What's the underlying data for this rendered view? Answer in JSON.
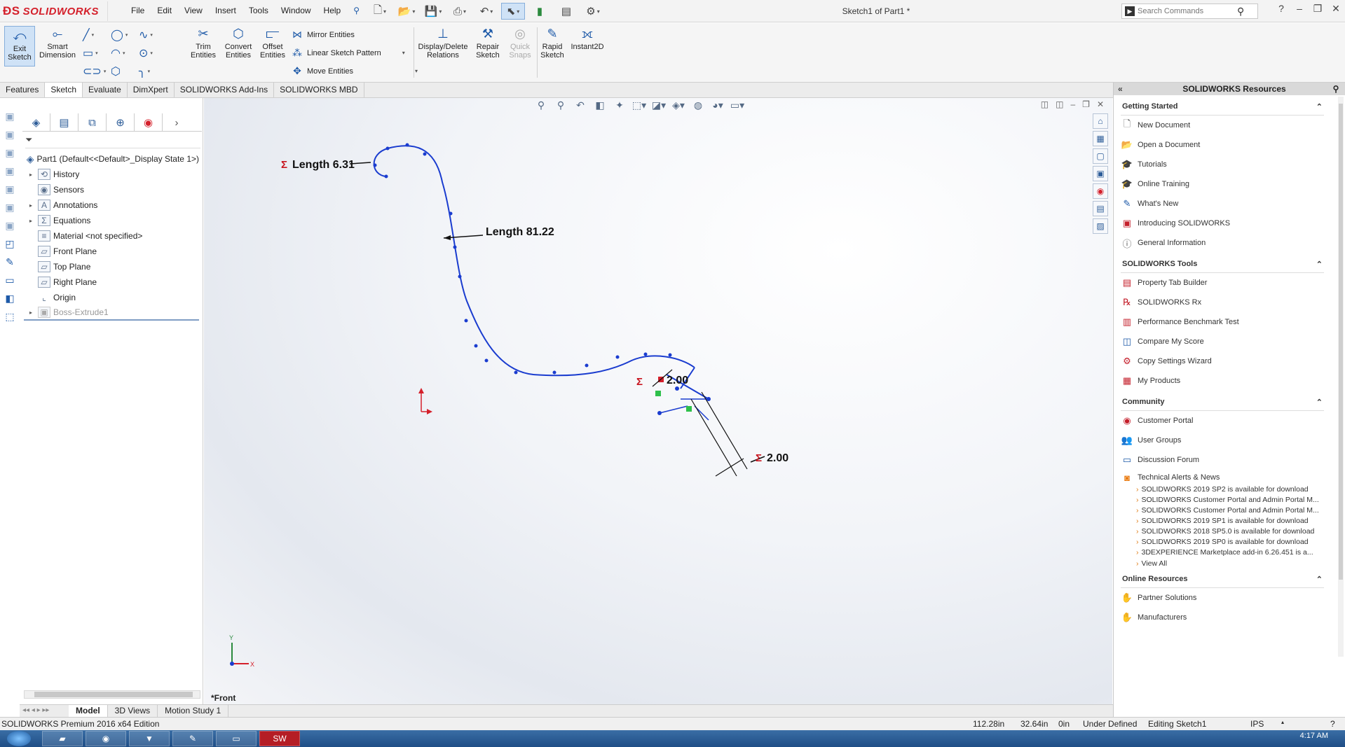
{
  "app": {
    "brand": "SOLIDWORKS",
    "doc_title": "Sketch1 of Part1 *"
  },
  "menu": [
    "File",
    "Edit",
    "View",
    "Insert",
    "Tools",
    "Window",
    "Help"
  ],
  "search": {
    "placeholder": "Search Commands"
  },
  "commands": {
    "exit_sketch": "Exit Sketch",
    "smart_dimension": "Smart Dimension",
    "trim_entities": "Trim Entities",
    "convert_entities": "Convert Entities",
    "offset_entities": "Offset Entities",
    "mirror_entities": "Mirror Entities",
    "linear_sketch_pattern": "Linear Sketch Pattern",
    "move_entities": "Move Entities",
    "display_delete_relations": "Display/Delete Relations",
    "repair_sketch": "Repair Sketch",
    "quick_snaps": "Quick Snaps",
    "rapid_sketch": "Rapid Sketch",
    "instant2d": "Instant2D"
  },
  "cm_tabs": [
    "Features",
    "Sketch",
    "Evaluate",
    "DimXpert",
    "SOLIDWORKS Add-Ins",
    "SOLIDWORKS MBD"
  ],
  "tree": {
    "root": "Part1  (Default<<Default>_Display State 1>)",
    "items": [
      "History",
      "Sensors",
      "Annotations",
      "Equations",
      "Material <not specified>",
      "Front Plane",
      "Top Plane",
      "Right Plane",
      "Origin",
      "Boss-Extrude1"
    ]
  },
  "model_tabs": [
    "Model",
    "3D Views",
    "Motion Study 1"
  ],
  "graphics": {
    "view_name": "*Front",
    "dims": {
      "length1": "Length 6.31",
      "length2": "Length 81.22",
      "dim_a": "2.00",
      "dim_b": "2.00"
    },
    "sigma": "Σ",
    "axis_x": "X",
    "axis_y": "Y"
  },
  "taskpane": {
    "title": "SOLIDWORKS Resources",
    "getting_started": {
      "title": "Getting Started",
      "items": [
        "New Document",
        "Open a Document",
        "Tutorials",
        "Online Training",
        "What's New",
        "Introducing SOLIDWORKS",
        "General Information"
      ]
    },
    "tools": {
      "title": "SOLIDWORKS Tools",
      "items": [
        "Property Tab Builder",
        "SOLIDWORKS Rx",
        "Performance Benchmark Test",
        "Compare My Score",
        "Copy Settings Wizard",
        "My Products"
      ]
    },
    "community": {
      "title": "Community",
      "items": [
        "Customer Portal",
        "User Groups",
        "Discussion Forum",
        "Technical Alerts & News"
      ]
    },
    "news": [
      "SOLIDWORKS 2019 SP2 is available for download",
      "SOLIDWORKS Customer Portal and Admin Portal M...",
      "SOLIDWORKS Customer Portal and Admin Portal M...",
      "SOLIDWORKS 2019 SP1 is available for download",
      "SOLIDWORKS 2018 SP5.0 is available for download",
      "SOLIDWORKS 2019 SP0 is available for download",
      "3DEXPERIENCE Marketplace add-in 6.26.451 is a..."
    ],
    "view_all": "View All",
    "online": {
      "title": "Online Resources",
      "items": [
        "Partner Solutions",
        "Manufacturers"
      ]
    }
  },
  "status": {
    "edition": "SOLIDWORKS Premium 2016 x64 Edition",
    "x": "112.28in",
    "y": "32.64in",
    "z": "0in",
    "state": "Under Defined",
    "mode": "Editing Sketch1",
    "units": "IPS"
  },
  "taskbar": {
    "time": "4:17 AM"
  }
}
